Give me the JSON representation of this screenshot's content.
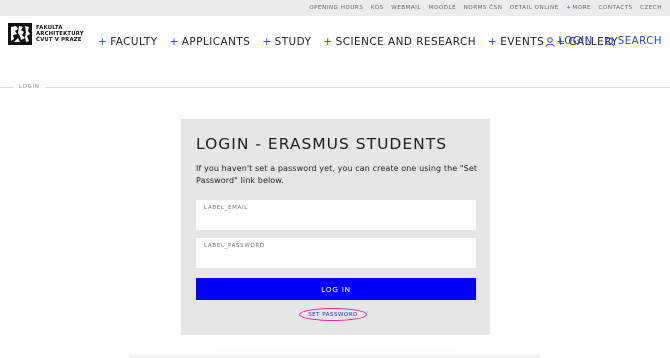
{
  "topbar": {
    "links": [
      {
        "label": "OPENING HOURS"
      },
      {
        "label": "KOS"
      },
      {
        "label": "WEBMAIL"
      },
      {
        "label": "MOODLE"
      },
      {
        "label": "NORMS ČSN"
      },
      {
        "label": "DETAIL ONLINE"
      },
      {
        "label": "MORE"
      },
      {
        "label": "CONTACTS"
      },
      {
        "label": "CZECH"
      }
    ]
  },
  "logo": {
    "line1": "FAKULTA",
    "line2": "ARCHITEKTURY",
    "line3": "ČVUT V PRAZE"
  },
  "nav": {
    "items": [
      {
        "label": "FACULTY"
      },
      {
        "label": "APPLICANTS"
      },
      {
        "label": "STUDY"
      },
      {
        "label": "SCIENCE AND RESEARCH"
      },
      {
        "label": "EVENTS"
      },
      {
        "label": "GALLERY"
      }
    ],
    "login_label": "LOGIN",
    "search_label": "SEARCH",
    "plus": "+"
  },
  "breadcrumb": {
    "label": "LOGIN"
  },
  "form": {
    "title": "LOGIN - ERASMUS STUDENTS",
    "description": "If you haven't set a password yet, you can create one using the \"Set Password\" link below.",
    "email_label": "LABEL_EMAIL",
    "email_value": "",
    "password_label": "LABEL_PASSWORD",
    "password_value": "",
    "submit_label": "LOG IN",
    "set_password_label": "SET PASSWORD"
  },
  "colors": {
    "accent": "#0000fe",
    "link_blue": "#2b3bf0",
    "highlight_circle": "#e0219a",
    "card_bg": "#e6e6e6",
    "topbar_bg": "#ececec"
  },
  "icons": {
    "login": "user-icon",
    "search": "search-icon"
  }
}
